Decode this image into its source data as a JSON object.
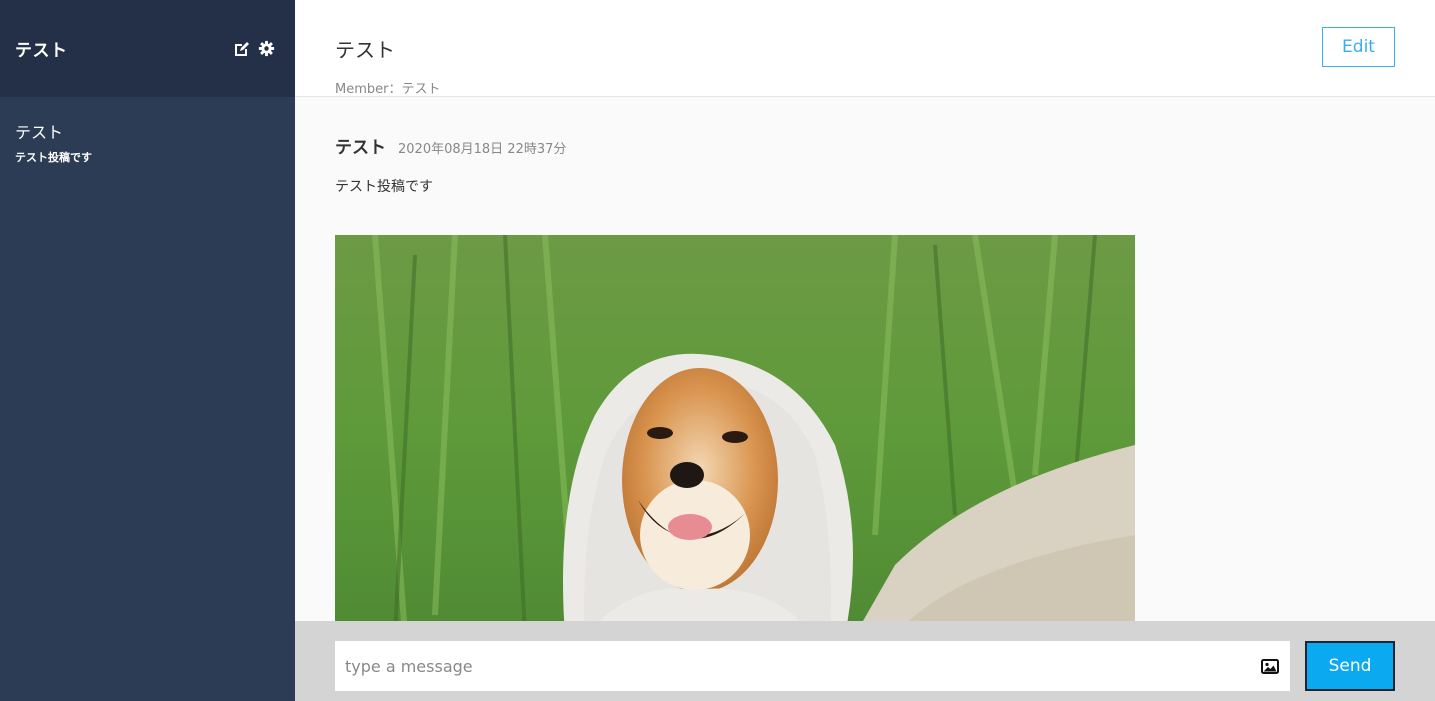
{
  "sidebar": {
    "user_name": "テスト",
    "icons": [
      "edit-icon",
      "gear-icon"
    ],
    "groups": [
      {
        "name": "テスト",
        "last_message": "テスト投稿です"
      }
    ]
  },
  "header": {
    "group_name": "テスト",
    "member_line": "Member：テスト",
    "edit_label": "Edit"
  },
  "messages": [
    {
      "user": "テスト",
      "date": "2020年08月18日 22時37分",
      "text": "テスト投稿です",
      "image": "shiba-inu-dog-in-white-hood-photo"
    }
  ],
  "form": {
    "placeholder": "type a message",
    "image_icon": "image-icon",
    "send_label": "Send"
  },
  "colors": {
    "sidebar_bg": "#2c3c55",
    "sidebar_header_bg": "#243047",
    "accent": "#38aef0",
    "send_bg": "#0aa9f0",
    "footer_bg": "#d4d4d4"
  }
}
